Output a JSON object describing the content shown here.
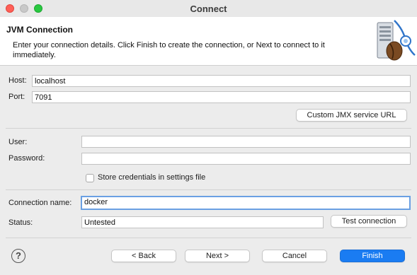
{
  "window": {
    "title": "Connect"
  },
  "banner": {
    "title": "JVM Connection",
    "description": "Enter your connection details. Click Finish to create the connection, or Next to connect to it immediately.",
    "icon": "jvm-coffee-bean-server-icon"
  },
  "form": {
    "host": {
      "label": "Host:",
      "value": "localhost"
    },
    "port": {
      "label": "Port:",
      "value": "7091"
    },
    "custom_jmx_label": "Custom JMX service URL",
    "user": {
      "label": "User:",
      "value": ""
    },
    "password": {
      "label": "Password:",
      "value": ""
    },
    "store_credentials": {
      "label": "Store credentials in settings file",
      "checked": false
    },
    "connection_name": {
      "label": "Connection name:",
      "value": "docker"
    },
    "status": {
      "label": "Status:",
      "value": "Untested"
    },
    "test_connection_label": "Test connection"
  },
  "footer": {
    "help_glyph": "?",
    "back_label": "< Back",
    "next_label": "Next >",
    "cancel_label": "Cancel",
    "finish_label": "Finish"
  },
  "colors": {
    "accent": "#1a7cf2",
    "close": "#ff5f57",
    "maximize": "#28c840",
    "focus_ring": "#6aa0e3"
  }
}
